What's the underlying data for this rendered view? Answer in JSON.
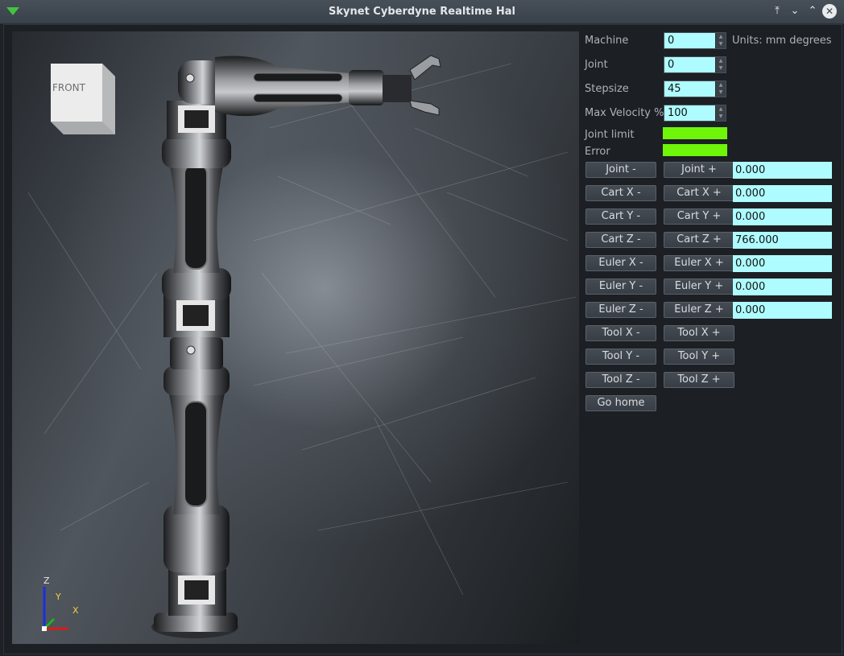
{
  "window": {
    "title": "Skynet Cyberdyne Realtime Hal",
    "icons": [
      "app-menu-icon",
      "keep-above-icon",
      "minimize-icon",
      "maximize-icon",
      "close-icon"
    ]
  },
  "viewport": {
    "nav_cube_face": "FRONT",
    "axes": {
      "x": "X",
      "y": "Y",
      "z": "Z"
    },
    "colors": {
      "x": "#e01818",
      "y": "#18b818",
      "z": "#1830e0"
    }
  },
  "controls": {
    "machine": {
      "label": "Machine",
      "value": "0"
    },
    "joint": {
      "label": "Joint",
      "value": "0"
    },
    "stepsize": {
      "label": "Stepsize",
      "value": "45"
    },
    "max_velocity": {
      "label": "Max Velocity %",
      "value": "100"
    },
    "units": "Units: mm degrees",
    "joint_limit": {
      "label": "Joint limit",
      "color": "#6ef50a"
    },
    "error": {
      "label": "Error",
      "color": "#6ef50a"
    }
  },
  "jog_rows": [
    {
      "minus": "Joint -",
      "plus": "Joint +",
      "value": "0.000"
    },
    {
      "minus": "Cart X -",
      "plus": "Cart X +",
      "value": "0.000"
    },
    {
      "minus": "Cart Y -",
      "plus": "Cart Y +",
      "value": "0.000"
    },
    {
      "minus": "Cart Z -",
      "plus": "Cart Z +",
      "value": "766.000"
    },
    {
      "minus": "Euler X -",
      "plus": "Euler X +",
      "value": "0.000"
    },
    {
      "minus": "Euler Y -",
      "plus": "Euler Y +",
      "value": "0.000"
    },
    {
      "minus": "Euler Z -",
      "plus": "Euler Z +",
      "value": "0.000"
    },
    {
      "minus": "Tool X -",
      "plus": "Tool X +"
    },
    {
      "minus": "Tool Y -",
      "plus": "Tool Y +"
    },
    {
      "minus": "Tool Z -",
      "plus": "Tool Z +"
    }
  ],
  "go_home": "Go home",
  "colors": {
    "field_bg": "#aefcff",
    "led_ok": "#6ef50a",
    "panel_bg": "#1c1f23"
  }
}
